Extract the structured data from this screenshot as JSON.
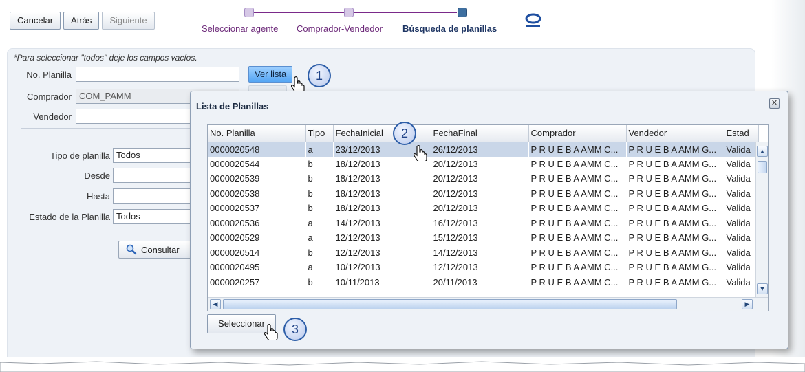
{
  "toolbar": {
    "cancel": "Cancelar",
    "back": "Atrás",
    "next": "Siguiente"
  },
  "train": {
    "steps": [
      {
        "label": "Seleccionar agente",
        "state": "done"
      },
      {
        "label": "Comprador-Vendedor",
        "state": "done"
      },
      {
        "label": "Búsqueda de planillas",
        "state": "current"
      }
    ]
  },
  "form": {
    "hint": "*Para seleccionar \"todos\" deje los campos vacíos.",
    "planilla_label": "No. Planilla",
    "planilla_value": "",
    "ver_lista": "Ver lista",
    "comprador_label": "Comprador",
    "comprador_value": "COM_PAMM",
    "vendedor_label": "Vendedor",
    "vendedor_value": "",
    "tipo_label": "Tipo de planilla",
    "tipo_value": "Todos",
    "desde_label": "Desde",
    "desde_value": "",
    "hasta_label": "Hasta",
    "hasta_value": "",
    "estado_label": "Estado de la Planilla",
    "estado_value": "Todos",
    "consultar": "Consultar"
  },
  "callouts": [
    "1",
    "2",
    "3"
  ],
  "dialog": {
    "title": "Lista de Planillas",
    "close": "✕",
    "select_button": "Seleccionar",
    "columns": [
      "No. Planilla",
      "Tipo",
      "FechaInicial",
      "FechaFinal",
      "Comprador",
      "Vendedor",
      "Estad"
    ],
    "rows": [
      [
        "0000020548",
        "a",
        "23/12/2013",
        "26/12/2013",
        "P R U E B A AMM C...",
        "P R U E B A AMM G...",
        "Valida"
      ],
      [
        "0000020544",
        "b",
        "18/12/2013",
        "20/12/2013",
        "P R U E B A AMM C...",
        "P R U E B A AMM G...",
        "Valida"
      ],
      [
        "0000020539",
        "b",
        "18/12/2013",
        "20/12/2013",
        "P R U E B A AMM C...",
        "P R U E B A AMM G...",
        "Valida"
      ],
      [
        "0000020538",
        "b",
        "18/12/2013",
        "20/12/2013",
        "P R U E B A AMM C...",
        "P R U E B A AMM G...",
        "Valida"
      ],
      [
        "0000020537",
        "b",
        "18/12/2013",
        "20/12/2013",
        "P R U E B A AMM C...",
        "P R U E B A AMM G...",
        "Valida"
      ],
      [
        "0000020536",
        "a",
        "14/12/2013",
        "16/12/2013",
        "P R U E B A AMM C...",
        "P R U E B A AMM G...",
        "Valida"
      ],
      [
        "0000020529",
        "a",
        "12/12/2013",
        "15/12/2013",
        "P R U E B A AMM C...",
        "P R U E B A AMM G...",
        "Valida"
      ],
      [
        "0000020514",
        "b",
        "12/12/2013",
        "14/12/2013",
        "P R U E B A AMM C...",
        "P R U E B A AMM G...",
        "Valida"
      ],
      [
        "0000020495",
        "a",
        "10/12/2013",
        "12/12/2013",
        "P R U E B A AMM C...",
        "P R U E B A AMM G...",
        "Valida"
      ],
      [
        "0000020257",
        "b",
        "10/11/2013",
        "20/11/2013",
        "P R U E B A AMM C...",
        "P R U E B A AMM G...",
        "Valida"
      ]
    ],
    "selected_row": 0
  },
  "colors": {
    "accent": "#7a2a8a",
    "train_current": "#1e3563",
    "selected_row": "#c9d6e8",
    "callout": "#2d5ea8"
  }
}
